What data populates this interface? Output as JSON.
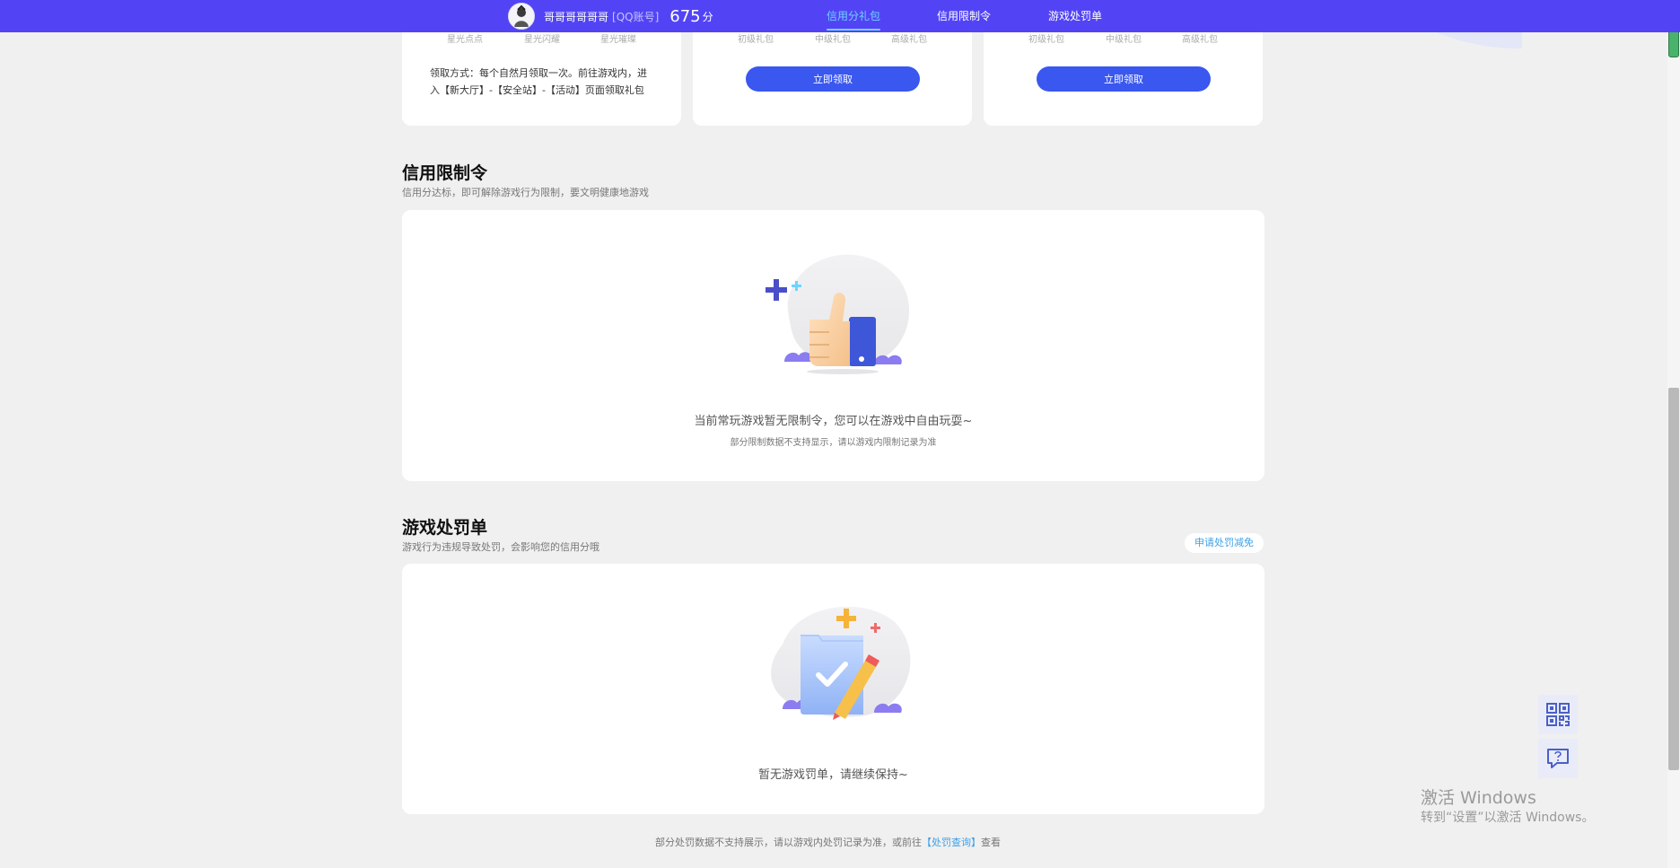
{
  "header": {
    "username": "哥哥哥哥哥哥",
    "account_tag": "[QQ账号]",
    "score": "675",
    "score_unit": "分",
    "nav": [
      {
        "label": "信用分礼包",
        "active": true
      },
      {
        "label": "信用限制令",
        "active": false
      },
      {
        "label": "游戏处罚单",
        "active": false
      }
    ]
  },
  "gift_cards": [
    {
      "tiers": [
        "星光点点",
        "星光闪耀",
        "星光璀璨"
      ],
      "method_text": "领取方式：每个自然月领取一次。前往游戏内，进入【新大厅】-【安全站】-【活动】页面领取礼包"
    },
    {
      "tiers": [
        "初级礼包",
        "中级礼包",
        "高级礼包"
      ],
      "button": "立即领取"
    },
    {
      "tiers": [
        "初级礼包",
        "中级礼包",
        "高级礼包"
      ],
      "button": "立即领取"
    }
  ],
  "restriction": {
    "title": "信用限制令",
    "subtitle": "信用分达标，即可解除游戏行为限制，要文明健康地游戏",
    "empty_main": "当前常玩游戏暂无限制令，您可以在游戏中自由玩耍~",
    "empty_sub": "部分限制数据不支持显示，请以游戏内限制记录为准"
  },
  "penalty": {
    "title": "游戏处罚单",
    "subtitle": "游戏行为违规导致处罚，会影响您的信用分哦",
    "appeal_button": "申请处罚减免",
    "empty_main": "暂无游戏罚单，请继续保持~",
    "footnote_before": "部分处罚数据不支持展示，请以游戏内处罚记录为准，或前往",
    "footnote_link": "【处罚查询】",
    "footnote_after": "查看"
  },
  "watermark": {
    "line1": "激活 Windows",
    "line2": "转到“设置”以激活 Windows。"
  },
  "icons": {
    "float_top": "qr-code-icon",
    "float_bottom": "help-chat-icon"
  },
  "colors": {
    "topbar": "#5244f5",
    "primary_button": "#3a57f0",
    "link": "#3fa0e6",
    "nav_active": "#6fd3ff"
  }
}
